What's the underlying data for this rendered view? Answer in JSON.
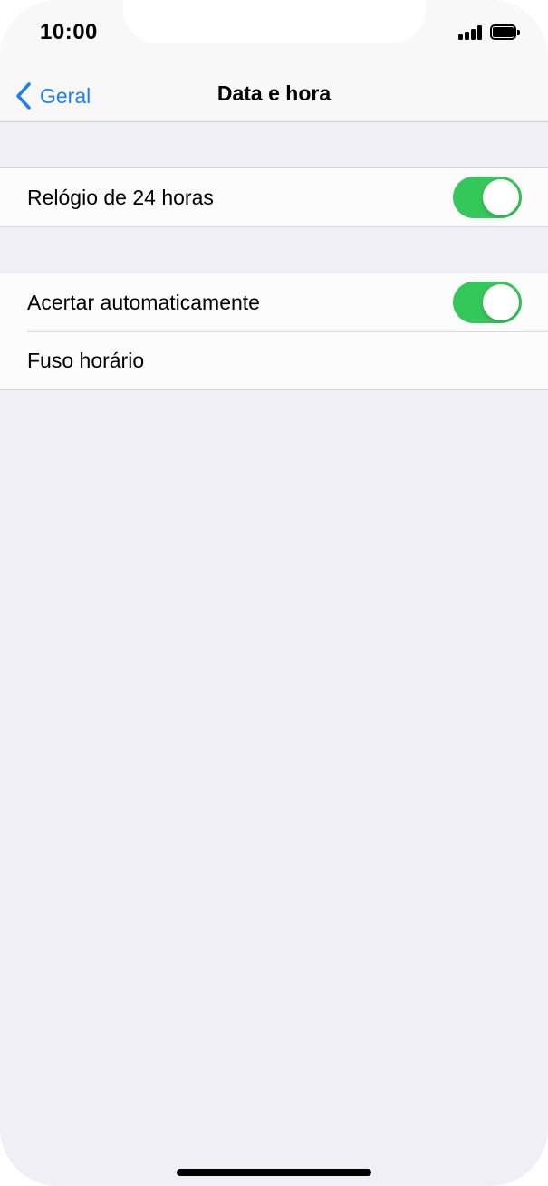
{
  "status_bar": {
    "time": "10:00"
  },
  "nav": {
    "back_label": "Geral",
    "title": "Data e hora"
  },
  "groups": [
    {
      "rows": [
        {
          "label": "Relógio de 24 horas",
          "toggle_on": true
        }
      ]
    },
    {
      "rows": [
        {
          "label": "Acertar automaticamente",
          "toggle_on": true
        },
        {
          "label": "Fuso horário"
        }
      ]
    }
  ],
  "colors": {
    "accent": "#1f7ef2",
    "toggle_on": "#34c759",
    "background": "#f0eff5"
  },
  "icons": {
    "back": "chevron-left-icon",
    "signal": "cellular-signal-icon",
    "battery": "battery-icon"
  }
}
